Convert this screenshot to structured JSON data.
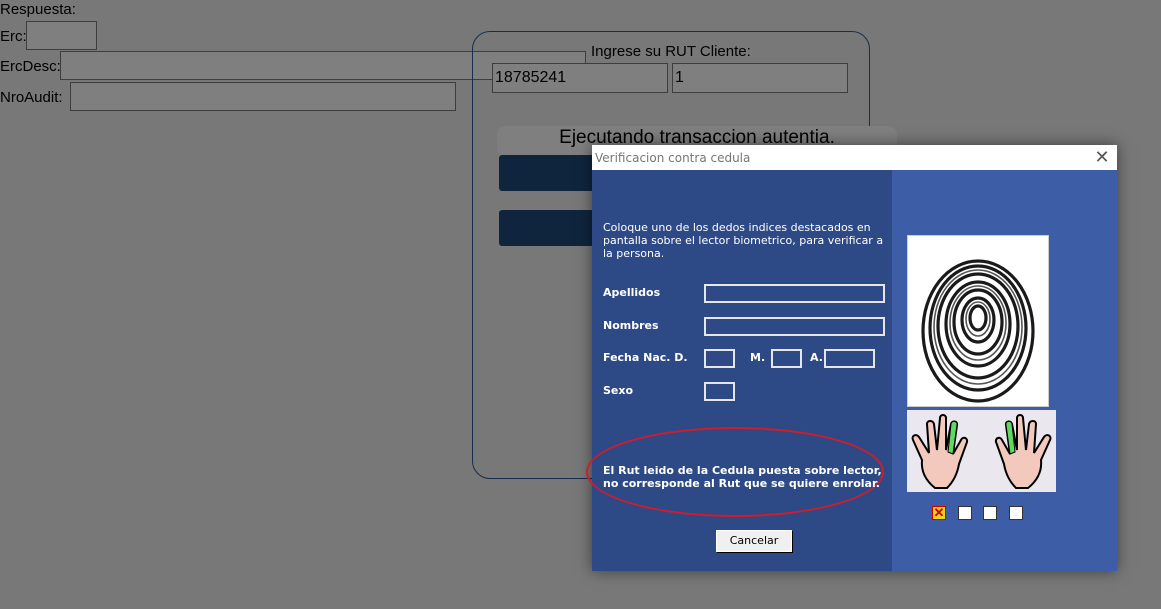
{
  "background": {
    "respuesta_label": "Respuesta:",
    "erc_label": "Erc:",
    "ercdesc_label": "ErcDesc:",
    "nroaudit_label": "NroAudit:",
    "rut_prompt": "Ingrese su RUT Cliente:",
    "rut_value": "18785241",
    "dv_value": "1",
    "status_message": "Ejecutando transaccion autentia.",
    "accent_color": "#1f4a7c"
  },
  "dialog": {
    "title": "Verificacion contra cedula",
    "instructions": "Coloque uno de los dedos indices destacados en pantalla sobre el lector biometrico,  para verificar a la persona.",
    "labels": {
      "apellidos": "Apellidos",
      "nombres": "Nombres",
      "fecha_nac_d": "Fecha Nac. D.",
      "m": "M.",
      "a": "A.",
      "sexo": "Sexo"
    },
    "error_message": "El Rut leido de la Cedula puesta sobre lector, no corresponde al Rut que se quiere enrolar.",
    "cancel_label": "Cancelar",
    "check_marker": "✕",
    "colors": {
      "left_panel": "#2e4a86",
      "right_panel": "#3d5ea6",
      "error_ellipse": "#d01c2c",
      "finger_highlight": "#5fd95f"
    }
  }
}
